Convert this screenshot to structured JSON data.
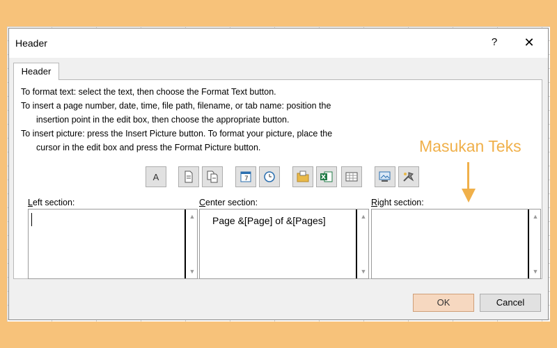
{
  "window": {
    "title": "Header",
    "help_label": "?",
    "close_label": "✕"
  },
  "tab": {
    "label": "Header"
  },
  "instructions": [
    "To format text:  select the text, then choose the Format Text button.",
    "To insert a page number, date, time, file path, filename, or tab name:  position the",
    "insertion point in the edit box, then choose the appropriate button.",
    "To insert picture: press the Insert Picture button.  To format your picture, place the",
    "cursor in the edit box and press the Format Picture button."
  ],
  "annotation": {
    "text": "Masukan Teks",
    "color": "#f0b04a"
  },
  "toolbar": {
    "format_text_label": "A",
    "insert_date_label": "7",
    "buttons": [
      {
        "name": "format-text",
        "icon": "font-A-icon"
      },
      {
        "name": "insert-page-number",
        "icon": "page-number-icon"
      },
      {
        "name": "insert-number-of-pages",
        "icon": "number-of-pages-icon"
      },
      {
        "name": "insert-date",
        "icon": "calendar-icon"
      },
      {
        "name": "insert-time",
        "icon": "clock-icon"
      },
      {
        "name": "insert-file-path",
        "icon": "folder-icon"
      },
      {
        "name": "insert-file-name",
        "icon": "excel-file-icon"
      },
      {
        "name": "insert-sheet-name",
        "icon": "sheet-tab-icon"
      },
      {
        "name": "insert-picture",
        "icon": "picture-icon"
      },
      {
        "name": "format-picture",
        "icon": "format-picture-icon"
      }
    ]
  },
  "sections": {
    "left": {
      "label_prefix": "L",
      "label_rest": "eft section:",
      "value": ""
    },
    "center": {
      "label_prefix": "C",
      "label_rest": "enter section:",
      "value": "Page &[Page] of &[Pages]"
    },
    "right": {
      "label_prefix": "R",
      "label_rest": "ight section:",
      "value": ""
    }
  },
  "buttons": {
    "ok": "OK",
    "cancel": "Cancel"
  },
  "colors": {
    "background": "#f7c27a",
    "dialog": "#f0f0f0",
    "ok_button": "#f6d8c0",
    "accent_annotation": "#f0b04a"
  }
}
